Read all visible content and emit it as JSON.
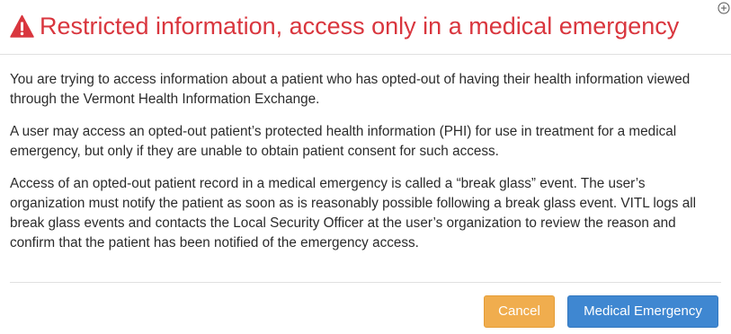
{
  "modal": {
    "title": "Restricted information, access only in a medical emergency",
    "title_color": "#d9363e",
    "icon": "warning-triangle-icon",
    "close_icon": "close-circle-icon",
    "paragraphs": [
      "You are trying to access information about a patient who has opted-out of having their health information viewed through the Vermont Health Information Exchange.",
      "A user may access an opted-out patient’s protected health information (PHI) for use in treatment for a medical emergency, but only if they are unable to obtain patient consent for such access.",
      "Access of an opted-out patient record in a medical emergency is called a “break glass” event. The user’s organization must notify the patient as soon as is reasonably possible following a break glass event. VITL logs all break glass events and contacts the Local Security Officer at the user’s organization to review the reason and confirm that the patient has been notified of the emergency access."
    ],
    "buttons": {
      "cancel_label": "Cancel",
      "cancel_color": "#f0ad4e",
      "emergency_label": "Medical Emergency",
      "emergency_color": "#3f87d1"
    }
  }
}
